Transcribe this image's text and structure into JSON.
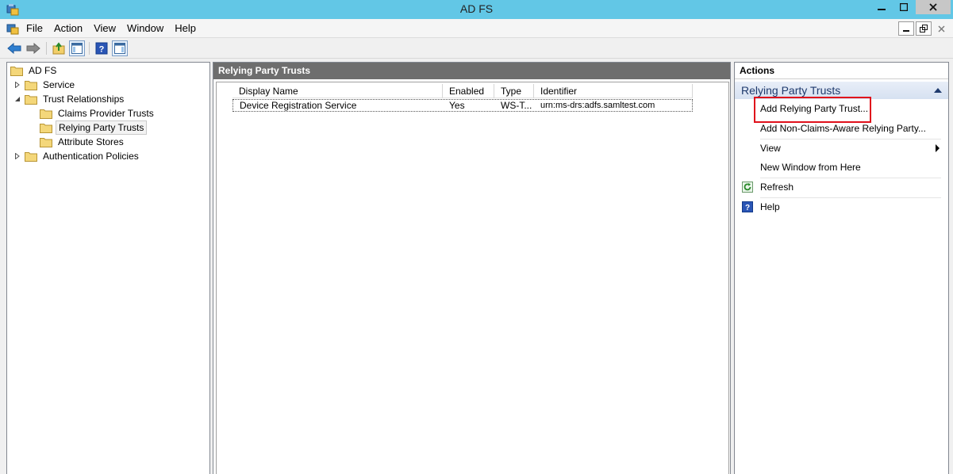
{
  "window": {
    "title": "AD FS"
  },
  "menu": [
    "File",
    "Action",
    "View",
    "Window",
    "Help"
  ],
  "tree": {
    "root": "AD FS",
    "items": [
      {
        "label": "Service"
      },
      {
        "label": "Trust Relationships"
      },
      {
        "label": "Claims Provider Trusts"
      },
      {
        "label": "Relying Party Trusts"
      },
      {
        "label": "Attribute Stores"
      },
      {
        "label": "Authentication Policies"
      }
    ]
  },
  "center": {
    "title": "Relying Party Trusts",
    "columns": [
      "Display Name",
      "Enabled",
      "Type",
      "Identifier"
    ],
    "rows": [
      {
        "name": "Device Registration Service",
        "enabled": "Yes",
        "type": "WS-T...",
        "identifier": "urn:ms-drs:adfs.samltest.com"
      }
    ]
  },
  "actions": {
    "title": "Actions",
    "section": "Relying Party Trusts",
    "items": [
      {
        "label": "Add Relying Party Trust..."
      },
      {
        "label": "Add Non-Claims-Aware Relying Party..."
      },
      {
        "label": "View"
      },
      {
        "label": "New Window from Here"
      },
      {
        "label": "Refresh"
      },
      {
        "label": "Help"
      }
    ]
  },
  "colors": {
    "titlebar": "#62c7e6",
    "highlight": "#e0101b",
    "section_text": "#1f3a6d"
  }
}
